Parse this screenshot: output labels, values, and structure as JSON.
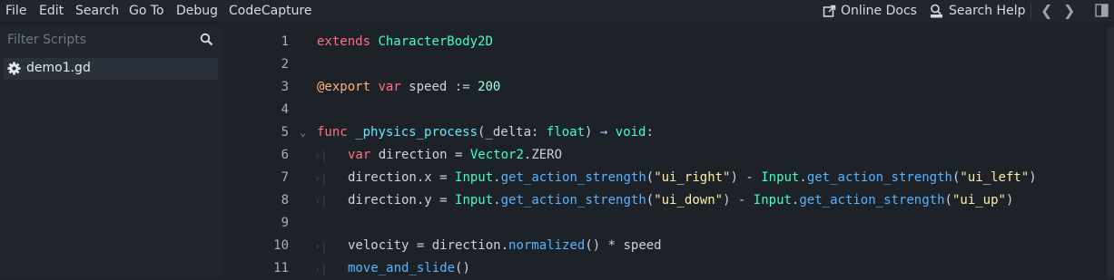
{
  "menu": [
    "File",
    "Edit",
    "Search",
    "Go To",
    "Debug",
    "CodeCapture"
  ],
  "toolbar": {
    "online_docs": "Online Docs",
    "search_help": "Search Help",
    "nav_back": "❮",
    "nav_forward": "❯"
  },
  "sidebar": {
    "filter_placeholder": "Filter Scripts",
    "scripts": [
      "demo1.gd"
    ]
  },
  "editor": {
    "line_numbers": [
      "1",
      "2",
      "3",
      "4",
      "5",
      "6",
      "7",
      "8",
      "9",
      "10",
      "11"
    ],
    "lines": [
      [
        {
          "t": "extends",
          "c": "kw"
        },
        {
          "t": " ",
          "c": ""
        },
        {
          "t": "CharacterBody2D",
          "c": "ty"
        }
      ],
      [],
      [
        {
          "t": "@export",
          "c": "an"
        },
        {
          "t": " ",
          "c": ""
        },
        {
          "t": "var",
          "c": "kw"
        },
        {
          "t": " speed ",
          "c": ""
        },
        {
          "t": ":=",
          "c": "op"
        },
        {
          "t": " ",
          "c": ""
        },
        {
          "t": "200",
          "c": "num"
        }
      ],
      [],
      [
        {
          "t": "func",
          "c": "kw"
        },
        {
          "t": " ",
          "c": ""
        },
        {
          "t": "_physics_process",
          "c": "fnd"
        },
        {
          "t": "(_delta: ",
          "c": ""
        },
        {
          "t": "float",
          "c": "ty"
        },
        {
          "t": ") ",
          "c": ""
        },
        {
          "t": "→",
          "c": "op"
        },
        {
          "t": " ",
          "c": ""
        },
        {
          "t": "void",
          "c": "ty"
        },
        {
          "t": ":",
          "c": ""
        }
      ],
      [
        {
          "t": "var",
          "c": "kw"
        },
        {
          "t": " direction = ",
          "c": ""
        },
        {
          "t": "Vector2",
          "c": "ty"
        },
        {
          "t": ".ZERO",
          "c": ""
        }
      ],
      [
        {
          "t": "direction.x = ",
          "c": ""
        },
        {
          "t": "Input",
          "c": "ty"
        },
        {
          "t": ".",
          "c": ""
        },
        {
          "t": "get_action_strength",
          "c": "fn"
        },
        {
          "t": "(",
          "c": ""
        },
        {
          "t": "\"ui_right\"",
          "c": "str"
        },
        {
          "t": ") - ",
          "c": ""
        },
        {
          "t": "Input",
          "c": "ty"
        },
        {
          "t": ".",
          "c": ""
        },
        {
          "t": "get_action_strength",
          "c": "fn"
        },
        {
          "t": "(",
          "c": ""
        },
        {
          "t": "\"ui_left\"",
          "c": "str"
        },
        {
          "t": ")",
          "c": ""
        }
      ],
      [
        {
          "t": "direction.y = ",
          "c": ""
        },
        {
          "t": "Input",
          "c": "ty"
        },
        {
          "t": ".",
          "c": ""
        },
        {
          "t": "get_action_strength",
          "c": "fn"
        },
        {
          "t": "(",
          "c": ""
        },
        {
          "t": "\"ui_down\"",
          "c": "str"
        },
        {
          "t": ") - ",
          "c": ""
        },
        {
          "t": "Input",
          "c": "ty"
        },
        {
          "t": ".",
          "c": ""
        },
        {
          "t": "get_action_strength",
          "c": "fn"
        },
        {
          "t": "(",
          "c": ""
        },
        {
          "t": "\"ui_up\"",
          "c": "str"
        },
        {
          "t": ")",
          "c": ""
        }
      ],
      [],
      [
        {
          "t": "velocity = direction.",
          "c": ""
        },
        {
          "t": "normalized",
          "c": "fn"
        },
        {
          "t": "() * speed",
          "c": ""
        }
      ],
      [
        {
          "t": "move_and_slide",
          "c": "fn"
        },
        {
          "t": "()",
          "c": ""
        }
      ]
    ]
  },
  "colors": {
    "background": "#1d2229",
    "panel": "#21262e",
    "keyword": "#ff7085",
    "type": "#42ffc2",
    "string": "#ffeda1",
    "function": "#57b3ff"
  },
  "icons": [
    "external-link-icon",
    "search-help-icon",
    "search-icon",
    "gear-icon",
    "fold-arrow-icon",
    "tab-indent-icon",
    "distraction-free-icon"
  ]
}
